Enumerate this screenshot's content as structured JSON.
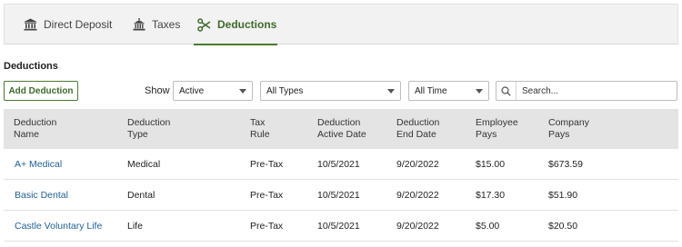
{
  "tabs": [
    {
      "label": "Direct Deposit",
      "icon": "bank-icon",
      "active": false
    },
    {
      "label": "Taxes",
      "icon": "government-building-icon",
      "active": false
    },
    {
      "label": "Deductions",
      "icon": "scissors-icon",
      "active": true
    }
  ],
  "section": {
    "title": "Deductions"
  },
  "toolbar": {
    "add_label": "Add Deduction",
    "show_label": "Show",
    "status_filter": "Active",
    "type_filter": "All Types",
    "time_filter": "All Time",
    "search_placeholder": "Search..."
  },
  "table": {
    "headers": [
      "Deduction\nName",
      "Deduction\nType",
      "Tax\nRule",
      "Deduction\nActive Date",
      "Deduction\nEnd Date",
      "Employee\nPays",
      "Company\nPays"
    ],
    "rows": [
      [
        "A+ Medical",
        "Medical",
        "Pre-Tax",
        "10/5/2021",
        "9/20/2022",
        "$15.00",
        "$673.59"
      ],
      [
        "Basic Dental",
        "Dental",
        "Pre-Tax",
        "10/5/2021",
        "9/20/2022",
        "$17.30",
        "$51.90"
      ],
      [
        "Castle Voluntary Life",
        "Life",
        "Pre-Tax",
        "10/5/2021",
        "9/20/2022",
        "$5.00",
        "$20.50"
      ]
    ]
  },
  "colors": {
    "accent": "#4b7a33",
    "link": "#1f5f99",
    "header_bg": "#e4e4e4"
  }
}
